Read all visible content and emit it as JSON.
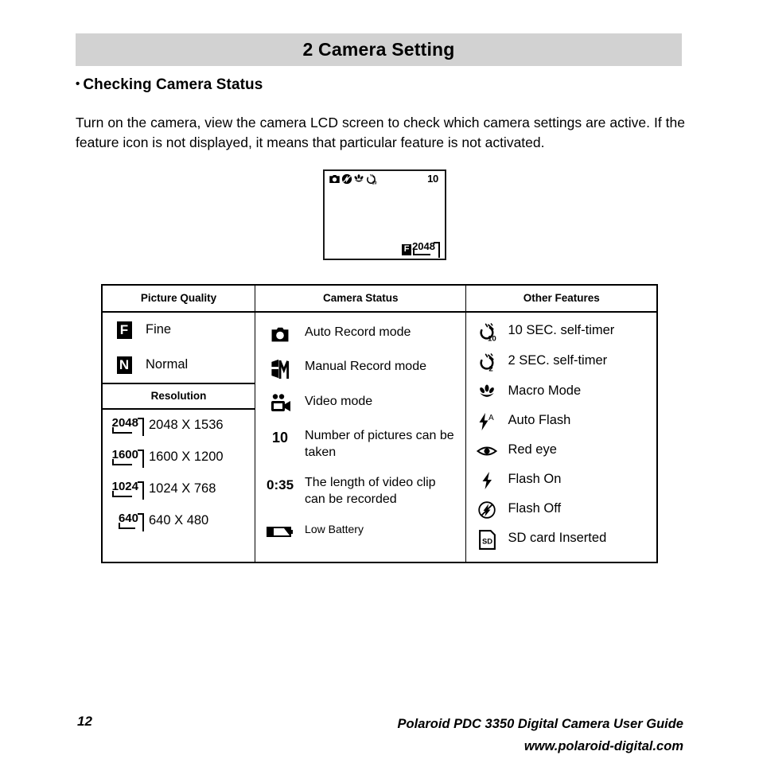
{
  "header": {
    "chapter_title": "2 Camera Setting",
    "banner_color": "#d2d2d2"
  },
  "section": {
    "heading": "Checking Camera Status",
    "bullet": "•",
    "paragraph": "Turn on the camera, view the camera LCD screen to check which camera settings are active. If the feature icon is not displayed, it means that particular feature is not activated."
  },
  "lcd_preview": {
    "top_icons": [
      "auto-record-icon",
      "flash-off-icon",
      "macro-icon",
      "self-timer-10-icon"
    ],
    "pictures_remaining": "10",
    "quality_letter": "F",
    "resolution_tag": "2048"
  },
  "table": {
    "columns": [
      {
        "header": "Picture Quality"
      },
      {
        "header": "Camera Status"
      },
      {
        "header": "Other Features"
      }
    ],
    "picture_quality": {
      "items": [
        {
          "icon": "quality-fine-icon",
          "letter": "F",
          "label": "Fine"
        },
        {
          "icon": "quality-normal-icon",
          "letter": "N",
          "label": "Normal"
        }
      ],
      "sub_header": "Resolution",
      "resolutions": [
        {
          "icon": "resolution-2048-icon",
          "tag": "2048",
          "label": "2048 X 1536"
        },
        {
          "icon": "resolution-1600-icon",
          "tag": "1600",
          "label": "1600 X 1200"
        },
        {
          "icon": "resolution-1024-icon",
          "tag": "1024",
          "label": "1024 X 768"
        },
        {
          "icon": "resolution-640-icon",
          "tag": "640",
          "label": "640 X 480"
        }
      ]
    },
    "camera_status": {
      "items": [
        {
          "icon": "auto-record-icon",
          "label": "Auto Record mode"
        },
        {
          "icon": "manual-record-icon",
          "label": "Manual Record mode"
        },
        {
          "icon": "video-mode-icon",
          "label": "Video mode"
        },
        {
          "icon": "picture-count-icon",
          "value": "10",
          "label": "Number of pictures can be taken"
        },
        {
          "icon": "video-length-icon",
          "value": "0:35",
          "label": "The length of video clip can be recorded"
        },
        {
          "icon": "low-battery-icon",
          "label": "Low Battery"
        }
      ]
    },
    "other_features": {
      "items": [
        {
          "icon": "self-timer-10-icon",
          "label": "10 SEC. self-timer"
        },
        {
          "icon": "self-timer-2-icon",
          "label": "2 SEC. self-timer"
        },
        {
          "icon": "macro-mode-icon",
          "label": "Macro Mode"
        },
        {
          "icon": "auto-flash-icon",
          "label": "Auto Flash"
        },
        {
          "icon": "red-eye-icon",
          "label": "Red eye"
        },
        {
          "icon": "flash-on-icon",
          "label": "Flash On"
        },
        {
          "icon": "flash-off-icon",
          "label": "Flash Off"
        },
        {
          "icon": "sd-card-icon",
          "label": "SD card Inserted"
        }
      ]
    }
  },
  "footer": {
    "page_number": "12",
    "product_line": "Polaroid  PDC 3350 Digital Camera User Guide",
    "website": "www.polaroid-digital.com"
  }
}
